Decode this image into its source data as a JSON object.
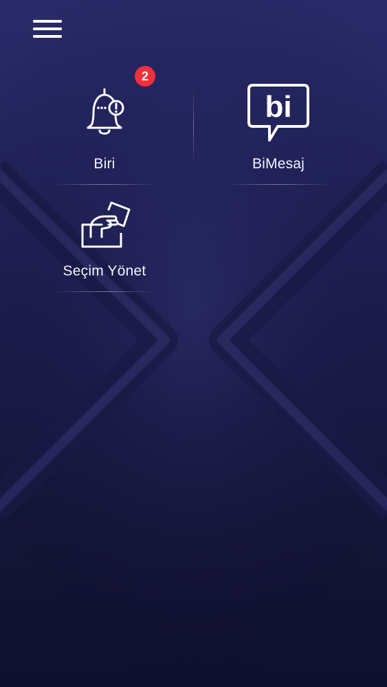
{
  "header": {
    "menu_icon": "hamburger-menu-icon"
  },
  "tiles": [
    {
      "label": "Biri",
      "icon": "bell-alert-icon",
      "badge": "2"
    },
    {
      "label": "BiMesaj",
      "icon": "bi-chat-bubble-icon",
      "icon_text": "bi"
    },
    {
      "label": "Seçim Yönet",
      "icon": "ballot-box-vote-icon"
    }
  ],
  "colors": {
    "background_top": "#2a2b6a",
    "background_bottom": "#101030",
    "badge": "#f0313b",
    "text": "#ffffff"
  }
}
